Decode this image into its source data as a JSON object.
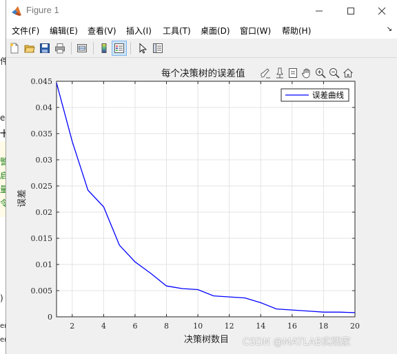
{
  "window": {
    "title": "Figure 1",
    "controls": {
      "minimize": "─",
      "maximize": "☐",
      "close": "✕"
    }
  },
  "menu": {
    "items": [
      "文件(F)",
      "编辑(E)",
      "查看(V)",
      "插入(I)",
      "工具(T)",
      "桌面(D)",
      "窗口(W)",
      "帮助(H)"
    ],
    "overflow_icon": "↘"
  },
  "toolbar": {
    "icons": [
      "new-figure-icon",
      "open-file-icon",
      "save-icon",
      "print-icon",
      "link-plot-icon",
      "colorbar-icon",
      "legend-icon",
      "pointer-icon",
      "property-inspector-icon"
    ]
  },
  "axes_toolbar": {
    "icons": [
      "brush-icon",
      "data-tips-icon",
      "insert-text-icon",
      "pan-icon",
      "zoom-in-icon",
      "zoom-out-icon",
      "home-icon"
    ]
  },
  "background_text": {
    "green": [
      "警",
      "启",
      "量",
      "令"
    ],
    "dark": [
      "件",
      "e",
      "十",
      ")",
      "er",
      "er"
    ]
  },
  "chart_data": {
    "type": "line",
    "title": "每个决策树的误差值",
    "xlabel": "决策树数目",
    "ylabel": "误差",
    "xlim": [
      1,
      20
    ],
    "ylim": [
      0,
      0.045
    ],
    "xticks": [
      2,
      4,
      6,
      8,
      10,
      12,
      14,
      16,
      18,
      20
    ],
    "yticks": [
      0,
      0.005,
      0.01,
      0.015,
      0.02,
      0.025,
      0.03,
      0.035,
      0.04,
      0.045
    ],
    "grid": true,
    "legend_location": "top-right",
    "series": [
      {
        "name": "误差曲线",
        "color": "#0000ff",
        "x": [
          1,
          2,
          3,
          4,
          5,
          6,
          7,
          8,
          9,
          10,
          11,
          12,
          13,
          14,
          15,
          16,
          17,
          18,
          19,
          20
        ],
        "y": [
          0.0447,
          0.0335,
          0.0242,
          0.021,
          0.0137,
          0.0105,
          0.0083,
          0.0059,
          0.0054,
          0.0052,
          0.004,
          0.0038,
          0.0036,
          0.0027,
          0.0015,
          0.0013,
          0.0011,
          0.0009,
          0.0009,
          0.0008
        ]
      }
    ]
  },
  "watermark": "CSDN @MATLAB实践家"
}
